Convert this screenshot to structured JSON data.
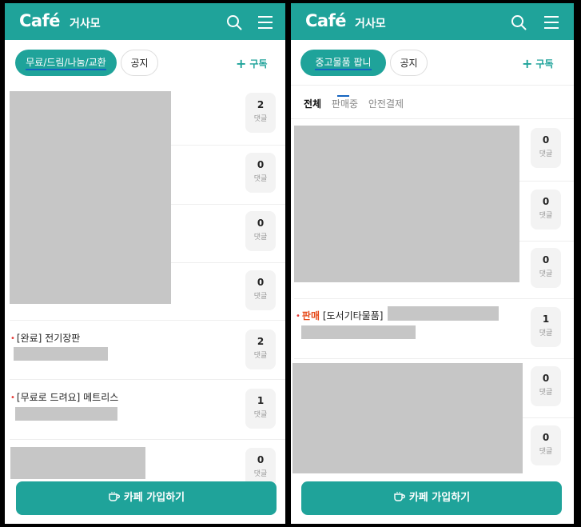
{
  "left": {
    "logo": "Café",
    "cafe_name": "거사모",
    "active_chip": "무료/드림/나눔/교환",
    "notice_chip": "공지",
    "subscribe": "구독",
    "comment_label": "댓글",
    "posts": [
      {
        "count": "2"
      },
      {
        "count": "0"
      },
      {
        "count": "0"
      },
      {
        "count": "0"
      },
      {
        "title": "[완료] 전기장판",
        "count": "2"
      },
      {
        "title": "[무료로 드려요] 메트리스",
        "count": "1"
      },
      {
        "count": "0"
      }
    ],
    "join_label": "카페 가입하기"
  },
  "right": {
    "logo": "Café",
    "cafe_name": "거사모",
    "active_chip": "중고물품 팝니다.",
    "notice_chip": "공지",
    "subscribe": "구독",
    "filter_tabs": [
      "전체",
      "판매중",
      "안전결제"
    ],
    "comment_label": "댓글",
    "posts": [
      {
        "count": "0"
      },
      {
        "count": "0"
      },
      {
        "count": "0"
      },
      {
        "sale_tag": "판매",
        "category": "[도서기타물품]",
        "count": "1"
      },
      {
        "count": "0"
      },
      {
        "count": "0"
      }
    ],
    "join_label": "카페 가입하기"
  },
  "colors": {
    "brand": "#1fa39a",
    "sale": "#e64a19",
    "dot": "#e53935",
    "placeholder": "#c6c6c6"
  }
}
